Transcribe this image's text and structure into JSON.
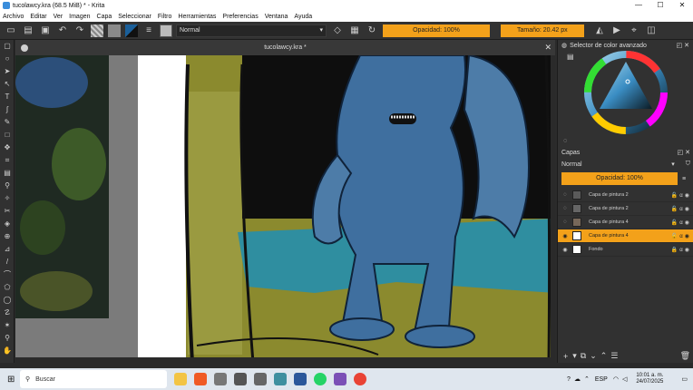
{
  "window": {
    "title": "tucolawcy.kra (68.5 MiB)  *  - Krita",
    "min_glyph": "—",
    "max_glyph": "☐",
    "close_glyph": "✕"
  },
  "menu": [
    "Archivo",
    "Editar",
    "Ver",
    "Imagen",
    "Capa",
    "Seleccionar",
    "Filtro",
    "Herramientas",
    "Preferencias",
    "Ventana",
    "Ayuda"
  ],
  "toolbar": {
    "brush_preset": "Normal",
    "opacity_label": "Opacidad: 100%",
    "size_label": "Tamaño: 20.42 px"
  },
  "document": {
    "tab_title": "tucolawcy.kra *",
    "close_glyph": "✕"
  },
  "color_selector": {
    "title": "Selector de color avanzado"
  },
  "layers": {
    "title": "Capas",
    "blend_mode": "Normal",
    "opacity_label": "Opacidad:  100%",
    "items": [
      {
        "name": "Capa de pintura 2",
        "active": false,
        "thumb": "#5a5a5a"
      },
      {
        "name": "Capa de pintura 2",
        "active": false,
        "thumb": "#666666"
      },
      {
        "name": "Capa de pintura 4",
        "active": false,
        "thumb": "#77685a"
      },
      {
        "name": "Capa de pintura 4",
        "active": true,
        "thumb": "#ffffff"
      },
      {
        "name": "Fondo",
        "active": false,
        "thumb": "#ffffff"
      }
    ]
  },
  "taskbar": {
    "search_placeholder": "Buscar",
    "language": "ESP",
    "time": "10:01 a. m.",
    "date": "24/07/2025"
  },
  "colors": {
    "accent": "#f3a11a",
    "olive": "#8b8a2e",
    "teal": "#2f8ea0",
    "creature": "#3f6f9f"
  }
}
